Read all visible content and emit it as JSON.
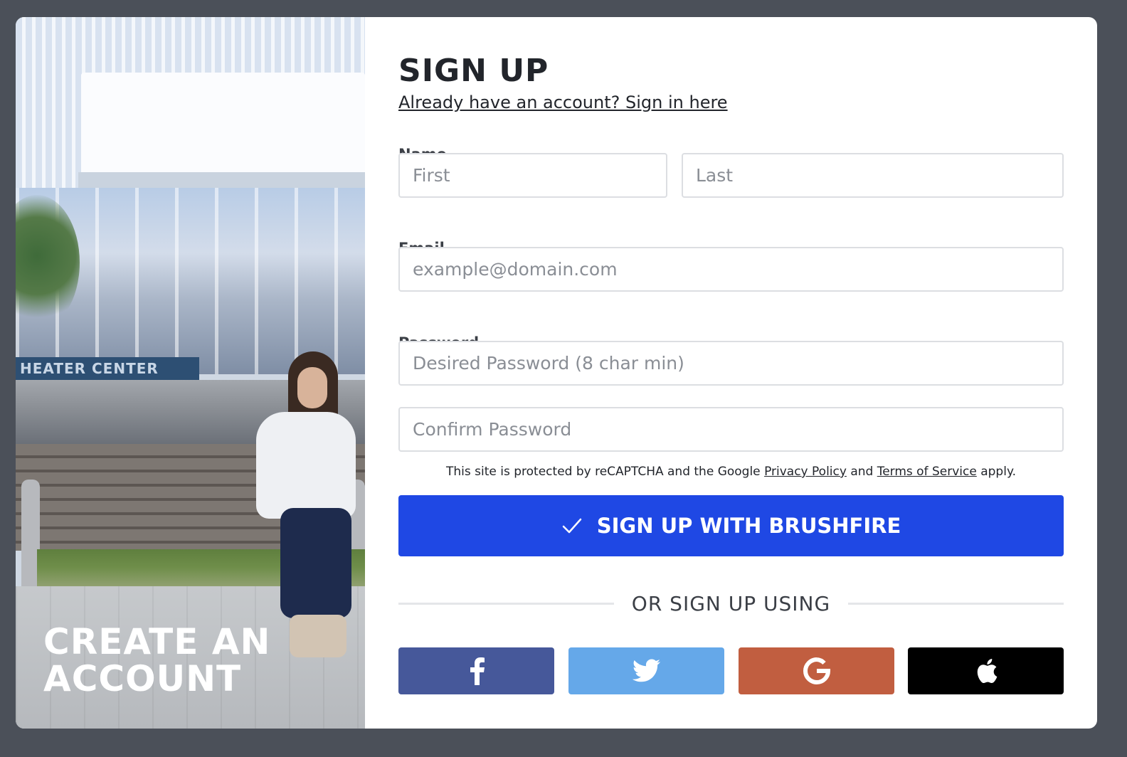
{
  "side_panel": {
    "title_line1": "CREATE AN",
    "title_line2": "ACCOUNT",
    "photo_sign_text": "HEATER CENTER"
  },
  "form": {
    "title": "SIGN UP",
    "signin_link": "Already have an account? Sign in here",
    "name_label": "Name",
    "first_placeholder": "First",
    "last_placeholder": "Last",
    "email_label": "Email",
    "email_placeholder": "example@domain.com",
    "password_label": "Password",
    "password_placeholder": "Desired Password (8 char min)",
    "confirm_placeholder": "Confirm Password",
    "recaptcha_prefix": "This site is protected by reCAPTCHA and the Google",
    "privacy_link": "Privacy Policy",
    "recaptcha_and": "and",
    "terms_link": "Terms of Service",
    "recaptcha_suffix": "apply.",
    "signup_button": "SIGN UP WITH BRUSHFIRE",
    "divider_text": "OR SIGN UP USING"
  },
  "social": [
    {
      "name": "facebook",
      "icon": "facebook-icon",
      "color": "#46589a"
    },
    {
      "name": "twitter",
      "icon": "twitter-icon",
      "color": "#65a8e9"
    },
    {
      "name": "google",
      "icon": "google-icon",
      "color": "#c15e40"
    },
    {
      "name": "apple",
      "icon": "apple-icon",
      "color": "#000000"
    }
  ],
  "colors": {
    "background": "#4b5059",
    "primary_button": "#1f48e4",
    "text": "#22252b"
  }
}
